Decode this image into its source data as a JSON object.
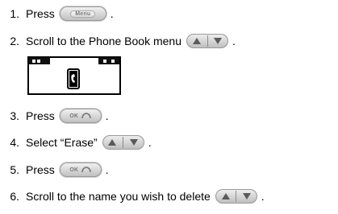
{
  "steps": [
    {
      "number": "1.",
      "text": "Press",
      "button": "Menu"
    },
    {
      "number": "2.",
      "text": "Scroll to the Phone Book menu"
    },
    {
      "number": "3.",
      "text": "Press",
      "button": "OK"
    },
    {
      "number": "4.",
      "text": "Select “Erase”"
    },
    {
      "number": "5.",
      "text": "Press",
      "button": "OK"
    },
    {
      "number": "6.",
      "text": "Scroll to the name you wish to delete"
    }
  ],
  "period": ".",
  "colors": {
    "text": "#000000",
    "button_face": "#d8d8d8",
    "button_label": "#777777",
    "nav_arrow": "#5a5a5a",
    "lcd_border": "#000000"
  },
  "icons": {
    "menu_button": "menu-key-icon",
    "nav_keys": "up-down-navigation-key-icon",
    "ok_button": "ok-key-icon",
    "lcd_phonebook": "phone-book-icon"
  }
}
